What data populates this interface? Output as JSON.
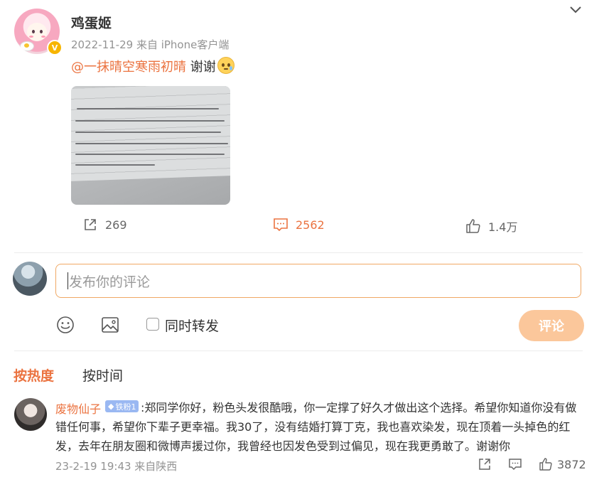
{
  "post": {
    "username": "鸡蛋姬",
    "meta": "2022-11-29  来自 iPhone客户端",
    "mention": "@一抹晴空寒雨初晴",
    "text": " 谢谢",
    "actions": {
      "repost_count": "269",
      "comment_count": "2562",
      "like_count": "1.4万"
    }
  },
  "composer": {
    "placeholder": "发布你的评论",
    "repost_label": "同时转发",
    "submit_label": "评论"
  },
  "sort": {
    "hot": "按热度",
    "time": "按时间"
  },
  "comments": [
    {
      "name": "废物仙子",
      "badge": "铁粉1",
      "text": ":郑同学你好，粉色头发很酷哦，你一定撑了好久才做出这个选择。希望你知道你没有做错任何事，希望你下辈子更幸福。我30了，没有结婚打算丁克，我也喜欢染发，现在顶着一头掉色的红发，去年在朋友圈和微博声援过你，我曾经也因发色受到过偏见，现在我更勇敢了。谢谢你",
      "meta": "23-2-19 19:43  来自陕西",
      "like_count": "3872"
    }
  ],
  "colors": {
    "accent": "#eb7340",
    "submit_disabled": "#fbc79b",
    "muted": "#939393"
  }
}
